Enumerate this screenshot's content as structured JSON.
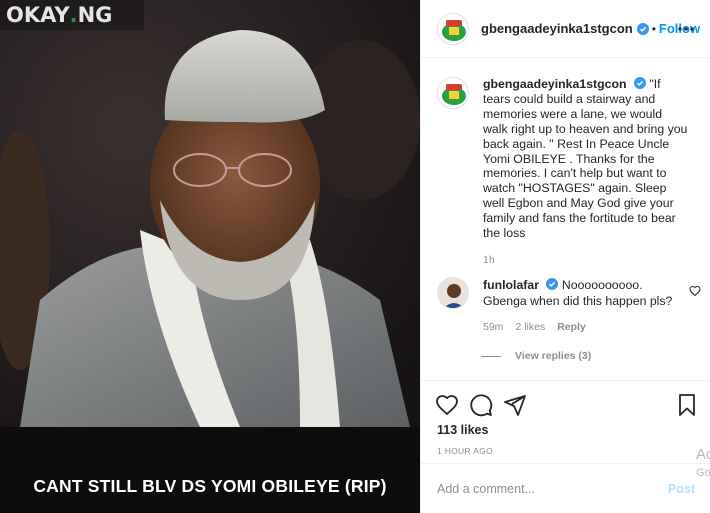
{
  "watermark": {
    "brand": "OKAY",
    "dot": ".",
    "suffix": "NG"
  },
  "photo": {
    "caption": "CANT STILL BLV DS YOMI OBILEYE (RIP)"
  },
  "header": {
    "username": "gbengaadeyinka1stgcon",
    "separator": "•",
    "follow_label": "Follow"
  },
  "post_caption": {
    "username": "gbengaadeyinka1stgcon",
    "text": "\"If tears could build a stairway and memories were a lane, we would walk right up to heaven and bring you back again. \" Rest In Peace Uncle Yomi OBILEYE . Thanks for the memories. I can't help but want to watch \"HOSTAGES\" again. Sleep well Egbon and May God give your family and fans the fortitude to bear the loss",
    "age": "1h"
  },
  "comment": {
    "username": "funlolafar",
    "text": "Noooooooooo. Gbenga when did this happen pls?",
    "age": "59m",
    "likes": "2 likes",
    "reply_label": "Reply"
  },
  "view_replies": "View replies (3)",
  "actions": {
    "likes": "113 likes",
    "timestamp": "1 HOUR AGO"
  },
  "add_comment": {
    "placeholder": "Add a comment...",
    "post_label": "Post"
  },
  "os_overlay": {
    "line1": "Ac",
    "line2": "Go"
  },
  "colors": {
    "accent": "#0095f6",
    "post_disabled": "#b2dffc",
    "text": "#262626",
    "muted": "#8e8e8e",
    "avatar_green": "#2e9e3e"
  },
  "icons": [
    "heart-icon",
    "comment-icon",
    "share-icon",
    "bookmark-icon",
    "more-options-icon",
    "verified-badge-icon"
  ]
}
